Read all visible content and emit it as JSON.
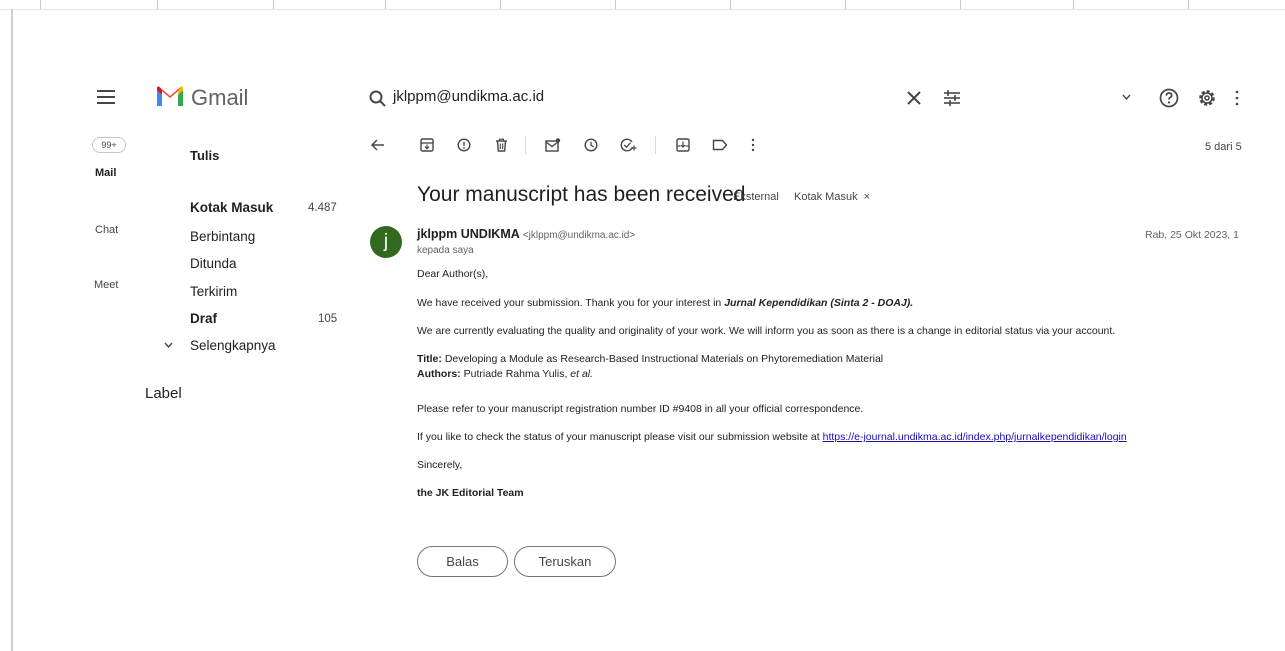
{
  "app": {
    "name": "Gmail"
  },
  "search": {
    "value": "jklppm@undikma.ac.id"
  },
  "rail": {
    "badge": "99+",
    "items": [
      {
        "label": "Mail"
      },
      {
        "label": "Chat"
      },
      {
        "label": "Meet"
      }
    ]
  },
  "nav": {
    "compose_label": "Tulis",
    "items": [
      {
        "label": "Kotak Masuk",
        "count": "4.487"
      },
      {
        "label": "Berbintang",
        "count": ""
      },
      {
        "label": "Ditunda",
        "count": ""
      },
      {
        "label": "Terkirim",
        "count": ""
      },
      {
        "label": "Draf",
        "count": "105"
      },
      {
        "label": "Selengkapnya",
        "count": ""
      }
    ],
    "labels_heading": "Label"
  },
  "toolbar": {
    "pager": "5 dari 5"
  },
  "message": {
    "subject": "Your manuscript has been received",
    "tags": [
      "Eksternal",
      "Kotak Masuk"
    ],
    "avatar_letter": "j",
    "sender_name": "jklppm UNDIKMA",
    "sender_email": "<jklppm@undikma.ac.id>",
    "recipient": "kepada saya",
    "date": "Rab, 25 Okt 2023, 1",
    "greeting": "Dear Author(s),",
    "para1_text": "We have received your submission. Thank you for your interest in ",
    "para1_journal": "Jurnal Kependidikan (Sinta 2 - DOAJ).",
    "para2": "We are currently evaluating the quality and originality of your work. We will inform you as soon as there is a change in editorial status via your account.",
    "title_label": "Title:",
    "title_value": " Developing a Module as Research-Based Instructional Materials on Phytoremediation Material",
    "authors_label": "Authors:",
    "authors_value": " Putriade Rahma Yulis, ",
    "authors_etal": "et al.",
    "para3": "Please refer to your manuscript registration number ID #9408 in all your official correspondence.",
    "para4_text": "If you like to check the status of your manuscript please visit our submission website at ",
    "para4_link": "https://e-journal.undikma.ac.id/index.php/jurnalkependidikan/login",
    "closing": "Sincerely,",
    "signature": "the JK Editorial Team"
  },
  "actions": {
    "reply_label": "Balas",
    "forward_label": "Teruskan"
  }
}
